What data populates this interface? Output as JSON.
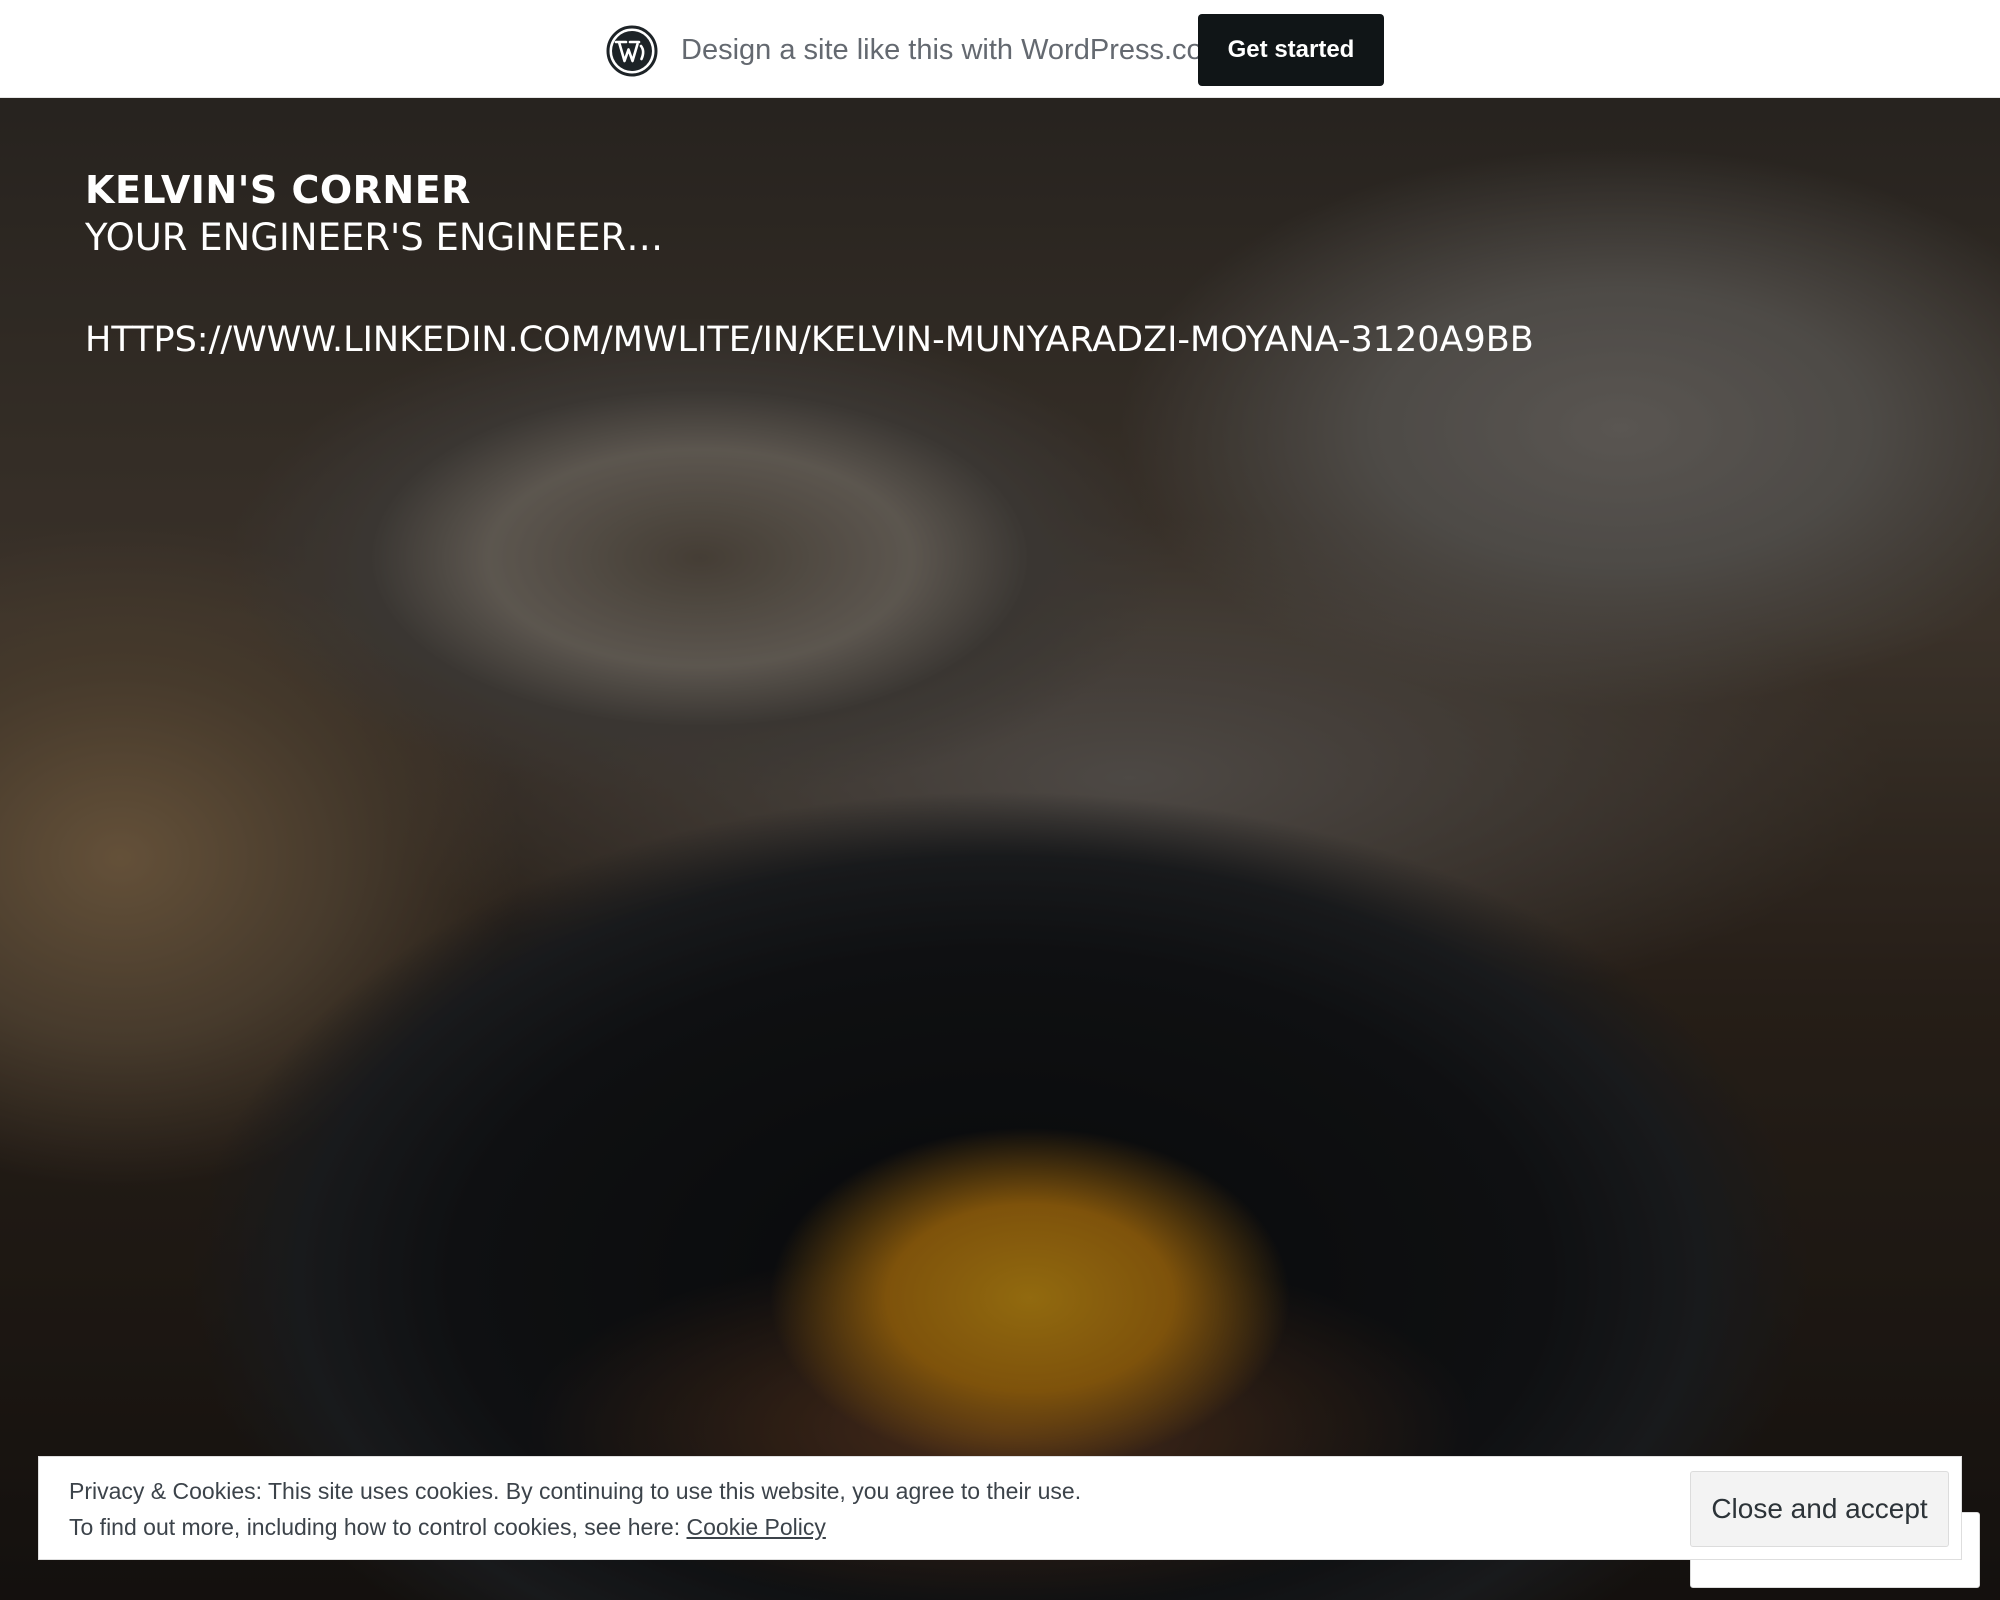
{
  "wp_banner": {
    "tagline": "Design a site like this with WordPress.com",
    "cta_label": "Get started",
    "logo_icon": "wordpress-logo-icon"
  },
  "header": {
    "site_title": "KELVIN'S CORNER",
    "site_description": "YOUR ENGINEER'S ENGINEER…",
    "link_text": "HTTPS://WWW.LINKEDIN.COM/MWLITE/IN/KELVIN-MUNYARADZI-MOYANA-3120A9BB"
  },
  "cookie_banner": {
    "line1": "Privacy & Cookies: This site uses cookies. By continuing to use this website, you agree to their use.",
    "line2_prefix": "To find out more, including how to control cookies, see here: ",
    "policy_link": "Cookie Policy",
    "accept_label": "Close and accept"
  },
  "colors": {
    "banner_bg": "#ffffff",
    "cta_bg": "#101517",
    "text_light": "#ffffff",
    "cookie_text": "#3c434a"
  }
}
